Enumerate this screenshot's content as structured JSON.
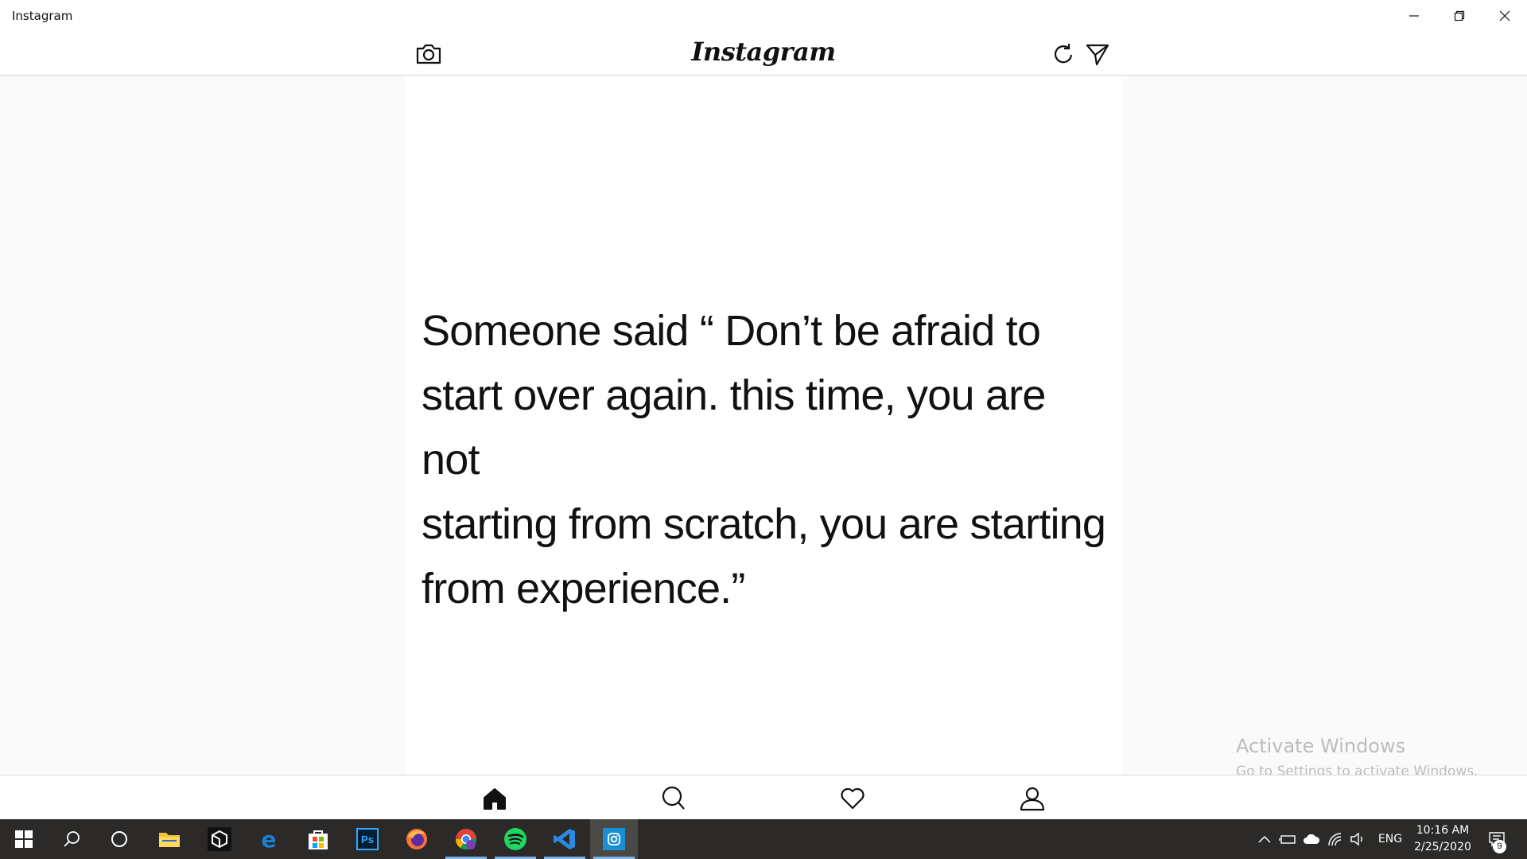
{
  "window": {
    "title": "Instagram"
  },
  "header": {
    "logo_text": "Instagram",
    "icons": [
      "camera-icon",
      "refresh-icon",
      "direct-message-icon"
    ]
  },
  "post": {
    "quote_lines": [
      "Someone said “ Don’t be afraid to",
      "start over again. this time, you are not",
      "starting from scratch, you are starting",
      "from experience.”"
    ]
  },
  "watermark": {
    "line1": "Activate Windows",
    "line2": "Go to Settings to activate Windows."
  },
  "bottom_nav": {
    "items": [
      "home-icon",
      "search-icon",
      "heart-icon",
      "profile-icon"
    ]
  },
  "taskbar": {
    "apps": [
      "start",
      "search",
      "cortana",
      "file-explorer",
      "unity",
      "edge",
      "store",
      "photoshop",
      "firefox",
      "chrome",
      "spotify",
      "vscode",
      "instagram"
    ],
    "photoshop_label": "Ps",
    "language": "ENG",
    "time": "10:16 AM",
    "date": "2/25/2020",
    "notification_count": "9"
  },
  "colors": {
    "taskbar_bg": "#2b2a28",
    "running_indicator": "#7fb4e6",
    "edge_blue": "#1e7fd6",
    "vscode_blue": "#2a8ae0",
    "instagram_tile": "#1b8fd6",
    "spotify_green": "#1ed760",
    "store_colors": [
      "#f25022",
      "#7fba00",
      "#00a4ef",
      "#ffb900"
    ]
  }
}
